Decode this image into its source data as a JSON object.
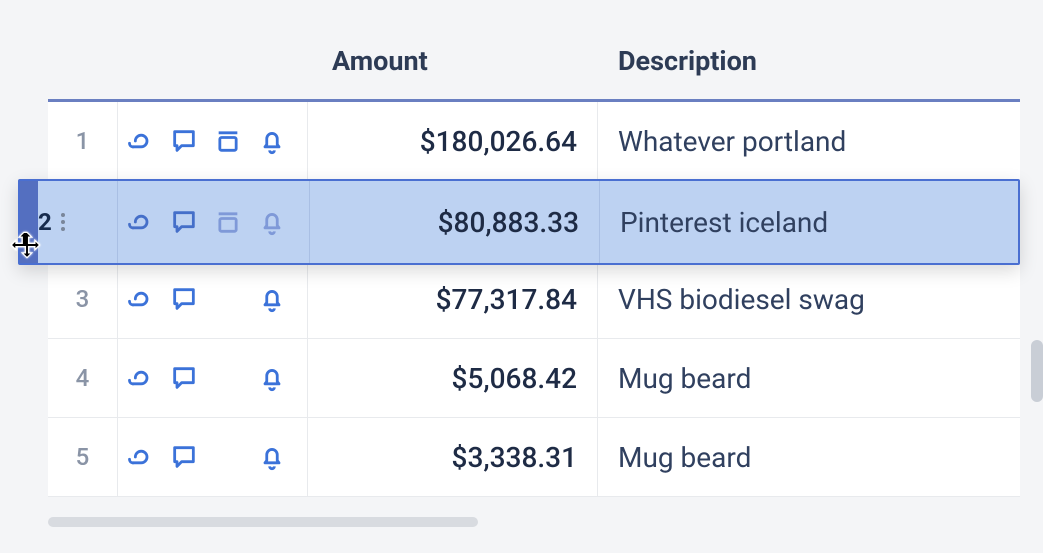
{
  "columns": {
    "amount_header": "Amount",
    "description_header": "Description"
  },
  "rows": [
    {
      "index": "1",
      "amount": "$180,026.64",
      "description": "Whatever portland",
      "has_archive": true,
      "selected": false
    },
    {
      "index": "2",
      "amount": "$80,883.33",
      "description": "Pinterest iceland",
      "has_archive": true,
      "selected": true
    },
    {
      "index": "3",
      "amount": "$77,317.84",
      "description": "VHS biodiesel swag",
      "has_archive": false,
      "selected": false
    },
    {
      "index": "4",
      "amount": "$5,068.42",
      "description": "Mug beard",
      "has_archive": false,
      "selected": false
    },
    {
      "index": "5",
      "amount": "$3,338.31",
      "description": "Mug beard",
      "has_archive": false,
      "selected": false
    }
  ],
  "icons": {
    "attachment": "attachment-icon",
    "comment": "comment-icon",
    "archive": "archive-icon",
    "bell": "bell-icon",
    "dots": "more-dots-icon",
    "move": "move-cursor-icon"
  },
  "colors": {
    "accent": "#3b72d9",
    "selected_bg": "#bdd2f2",
    "selected_border": "#4a6fd1",
    "selected_handle": "#546fc0"
  }
}
